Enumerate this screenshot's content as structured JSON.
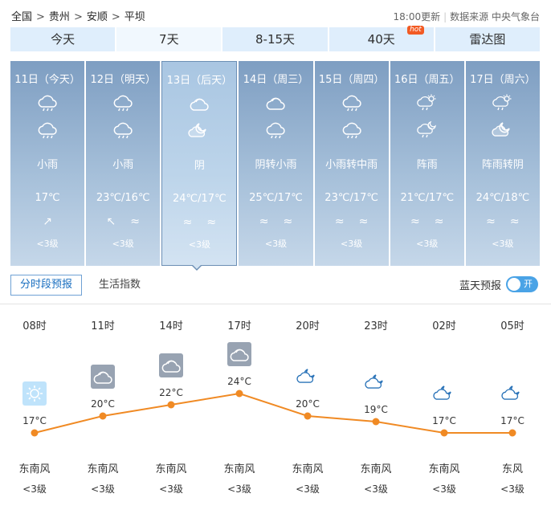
{
  "breadcrumb": [
    "全国",
    "贵州",
    "安顺",
    "平坝"
  ],
  "breadcrumb_sep": ">",
  "update_time": "18:00更新",
  "data_source": "数据来源 中央气象台",
  "tabs": [
    {
      "label": "今天",
      "badge": ""
    },
    {
      "label": "7天",
      "badge": ""
    },
    {
      "label": "8-15天",
      "badge": ""
    },
    {
      "label": "40天",
      "badge": "hot"
    },
    {
      "label": "雷达图",
      "badge": ""
    }
  ],
  "active_tab": 1,
  "days": [
    {
      "title": "11日（今天）",
      "icon_day": "rain-cloud-icon",
      "icon_night": "",
      "desc": "小雨",
      "temp": "17℃",
      "wind_dir": [
        "↗"
      ],
      "wind_level": "<3级"
    },
    {
      "title": "12日（明天）",
      "icon_day": "rain-cloud-icon",
      "icon_night": "rain-cloud-icon",
      "desc": "小雨",
      "temp": "23℃/16℃",
      "wind_dir": [
        "↖",
        "≈"
      ],
      "wind_level": "<3级"
    },
    {
      "title": "13日（后天）",
      "icon_day": "overcast-icon",
      "icon_night": "cloudy-moon-icon",
      "desc": "阴",
      "temp": "24℃/17℃",
      "wind_dir": [
        "≈",
        "≈"
      ],
      "wind_level": "<3级"
    },
    {
      "title": "14日（周三）",
      "icon_day": "overcast-icon",
      "icon_night": "rain-cloud-icon",
      "desc": "阴转小雨",
      "temp": "25℃/17℃",
      "wind_dir": [
        "≈",
        "≈"
      ],
      "wind_level": "<3级"
    },
    {
      "title": "15日（周四）",
      "icon_day": "rain-cloud-icon",
      "icon_night": "rain-cloud-icon",
      "desc": "小雨转中雨",
      "temp": "23℃/17℃",
      "wind_dir": [
        "≈",
        "≈"
      ],
      "wind_level": "<3级"
    },
    {
      "title": "16日（周五）",
      "icon_day": "shower-sun-icon",
      "icon_night": "shower-moon-icon",
      "desc": "阵雨",
      "temp": "21℃/17℃",
      "wind_dir": [
        "≈",
        "≈"
      ],
      "wind_level": "<3级"
    },
    {
      "title": "17日（周六）",
      "icon_day": "shower-sun-icon",
      "icon_night": "cloudy-moon-icon",
      "desc": "阵雨转阴",
      "temp": "24℃/18℃",
      "wind_dir": [
        "≈",
        "≈"
      ],
      "wind_level": "<3级"
    }
  ],
  "active_day": 2,
  "subtabs": {
    "hourly": "分时段预报",
    "life": "生活指数"
  },
  "bluesky": {
    "label": "蓝天预报",
    "toggle": "开"
  },
  "hourly": [
    {
      "time": "08时",
      "icon": "sunny-icon",
      "temp": 17,
      "temp_label": "17°C",
      "wind": "东南风",
      "level": "<3级"
    },
    {
      "time": "11时",
      "icon": "overcast-icon",
      "temp": 20,
      "temp_label": "20°C",
      "wind": "东南风",
      "level": "<3级"
    },
    {
      "time": "14时",
      "icon": "overcast-icon",
      "temp": 22,
      "temp_label": "22°C",
      "wind": "东南风",
      "level": "<3级"
    },
    {
      "time": "17时",
      "icon": "overcast-icon",
      "temp": 24,
      "temp_label": "24°C",
      "wind": "东南风",
      "level": "<3级"
    },
    {
      "time": "20时",
      "icon": "cloudy-moon-icon",
      "temp": 20,
      "temp_label": "20°C",
      "wind": "东南风",
      "level": "<3级"
    },
    {
      "time": "23时",
      "icon": "cloudy-moon-icon",
      "temp": 19,
      "temp_label": "19°C",
      "wind": "东南风",
      "level": "<3级"
    },
    {
      "time": "02时",
      "icon": "cloudy-moon-icon",
      "temp": 17,
      "temp_label": "17°C",
      "wind": "东南风",
      "level": "<3级"
    },
    {
      "time": "05时",
      "icon": "cloudy-moon-icon",
      "temp": 17,
      "temp_label": "17°C",
      "wind": "东风",
      "level": "<3级"
    }
  ],
  "colors": {
    "line": "#f08a24",
    "tab_bg": "#dfeefc",
    "card_bg": "#8ba9cb",
    "accent": "#1a6fc0",
    "toggle": "#4aa3e6"
  }
}
